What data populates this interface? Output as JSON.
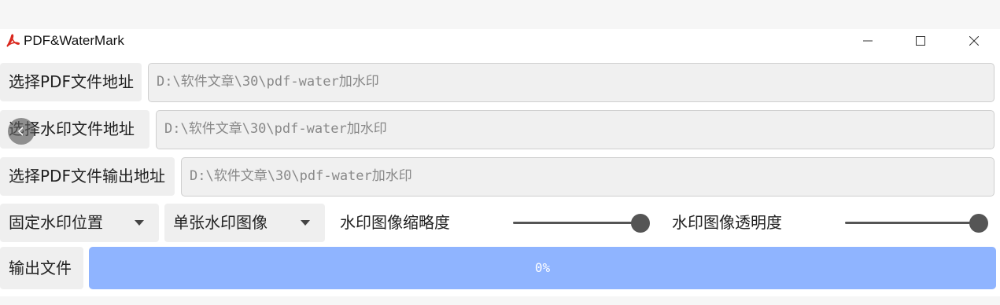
{
  "window": {
    "title": "PDF&WaterMark",
    "icon": "pdf-icon",
    "controls": [
      "minimize-icon",
      "maximize-icon",
      "close-icon"
    ]
  },
  "rows": {
    "pdf": {
      "button": "选择PDF文件地址",
      "value": "D:\\软件文章\\30\\pdf-water加水印"
    },
    "watermark": {
      "button": "选择水印文件地址",
      "value": "D:\\软件文章\\30\\pdf-water加水印"
    },
    "output": {
      "button": "选择PDF文件输出地址",
      "value": "D:\\软件文章\\30\\pdf-water加水印"
    }
  },
  "options": {
    "position_select": "固定水印位置",
    "mode_select": "单张水印图像",
    "scale_label": "水印图像缩略度",
    "scale_value": 1.0,
    "opacity_label": "水印图像透明度",
    "opacity_value": 1.0
  },
  "export": {
    "button": "输出文件",
    "progress_text": "0%",
    "progress_value": 1.0
  },
  "colors": {
    "progress": "#8fb4ff",
    "slider": "#555555",
    "pdf_icon": "#d9261c"
  },
  "overlay": {
    "back_icon": "chevron-left-icon"
  }
}
